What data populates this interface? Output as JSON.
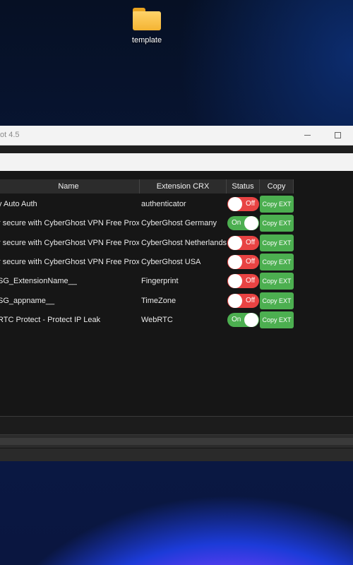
{
  "desktop": {
    "icon_label": "template",
    "icon": "folder-icon"
  },
  "window": {
    "title": "ot 4.5",
    "minimize_icon": "minimize-icon",
    "maximize_icon": "maximize-icon",
    "input_value": ""
  },
  "table": {
    "headers": {
      "name": "Name",
      "ext": "Extension CRX",
      "status": "Status",
      "copy": "Copy"
    },
    "rows": [
      {
        "name": "y Auto Auth",
        "ext": "authenticator",
        "status": "Off",
        "copy": "Copy EXT"
      },
      {
        "name": "r secure with CyberGhost VPN Free Proxy",
        "ext": "CyberGhost Germany",
        "status": "On",
        "copy": "Copy EXT"
      },
      {
        "name": "r secure with CyberGhost VPN Free Proxy",
        "ext": "CyberGhost Netherlands",
        "status": "Off",
        "copy": "Copy EXT"
      },
      {
        "name": "r secure with CyberGhost VPN Free Proxy",
        "ext": "CyberGhost USA",
        "status": "Off",
        "copy": "Copy EXT"
      },
      {
        "name": "SG_ExtensionName__",
        "ext": "Fingerprint",
        "status": "Off",
        "copy": "Copy EXT"
      },
      {
        "name": "SG_appname__",
        "ext": "TimeZone",
        "status": "Off",
        "copy": "Copy EXT"
      },
      {
        "name": "RTC Protect - Protect IP Leak",
        "ext": "WebRTC",
        "status": "On",
        "copy": "Copy EXT"
      }
    ]
  },
  "colors": {
    "toggle_off": "#e84343",
    "toggle_on": "#4caf50",
    "copy_button": "#4caf50"
  }
}
